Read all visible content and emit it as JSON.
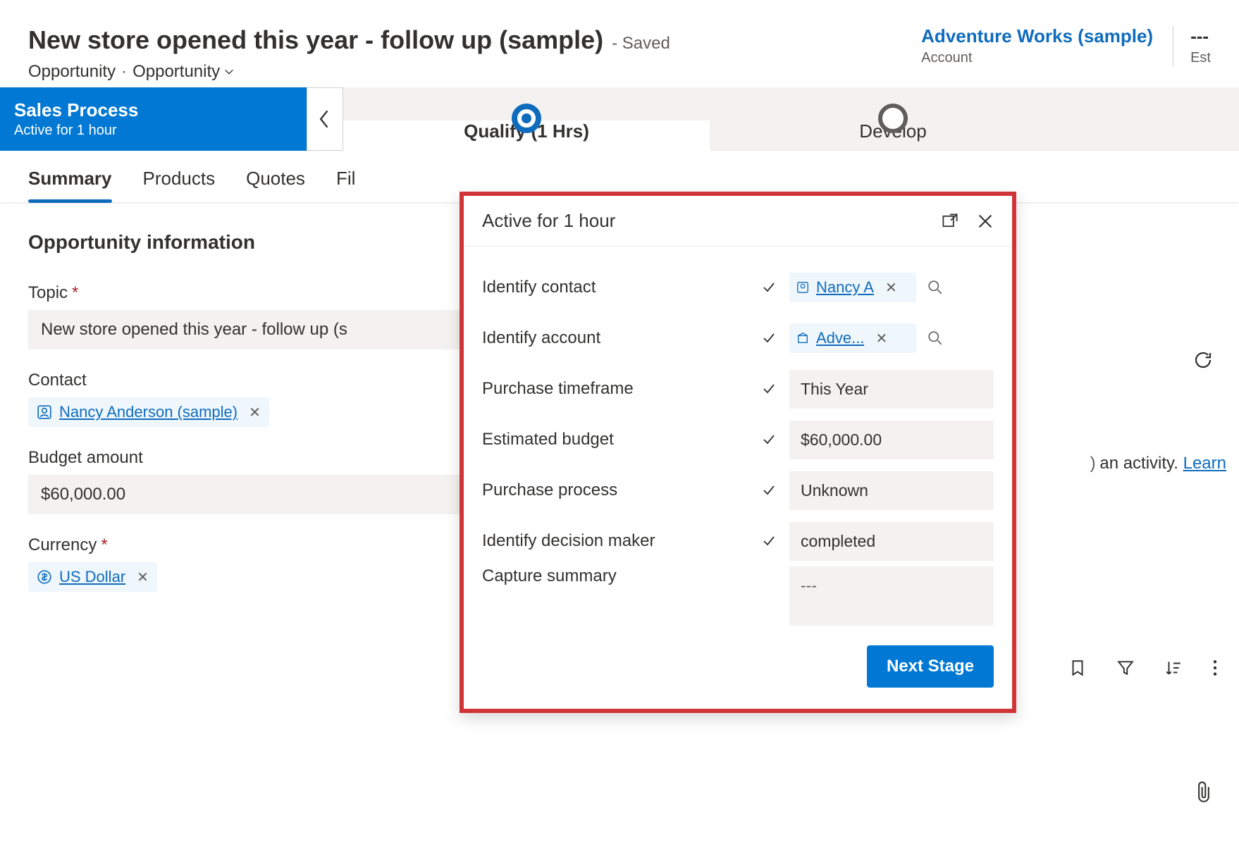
{
  "header": {
    "title": "New store opened this year - follow up (sample)",
    "saved_label": "- Saved",
    "entity": "Opportunity",
    "form_selector": "Opportunity",
    "right": {
      "account_link": "Adventure Works (sample)",
      "account_label": "Account",
      "est_dashes": "---",
      "est_label_partial": "Est"
    }
  },
  "bpf": {
    "name": "Sales Process",
    "active_for": "Active for 1 hour",
    "stages": [
      {
        "label": "Qualify  (1 Hrs)",
        "active": true
      },
      {
        "label": "Develop",
        "active": false
      }
    ]
  },
  "tabs": [
    {
      "label": "Summary",
      "active": true
    },
    {
      "label": "Products",
      "active": false
    },
    {
      "label": "Quotes",
      "active": false
    },
    {
      "label": "Fil",
      "active": false
    }
  ],
  "form": {
    "section": "Opportunity information",
    "topic": {
      "label": "Topic",
      "required": true,
      "value": "New store opened this year - follow up (s"
    },
    "contact": {
      "label": "Contact",
      "value": "Nancy Anderson (sample)"
    },
    "budget": {
      "label": "Budget amount",
      "value": "$60,000.00"
    },
    "currency": {
      "label": "Currency",
      "required": true,
      "value": "US Dollar"
    }
  },
  "flyout": {
    "title": "Active for 1 hour",
    "rows": [
      {
        "label": "Identify contact",
        "checked": true,
        "type": "lookup-contact",
        "value": "Nancy A"
      },
      {
        "label": "Identify account",
        "checked": true,
        "type": "lookup-account",
        "value": "Adve..."
      },
      {
        "label": "Purchase timeframe",
        "checked": true,
        "type": "text",
        "value": "This Year"
      },
      {
        "label": "Estimated budget",
        "checked": true,
        "type": "text",
        "value": "$60,000.00"
      },
      {
        "label": "Purchase process",
        "checked": true,
        "type": "text",
        "value": "Unknown"
      },
      {
        "label": "Identify decision maker",
        "checked": true,
        "type": "text",
        "value": "completed"
      },
      {
        "label": "Capture summary",
        "checked": false,
        "type": "textarea",
        "value": "---"
      }
    ],
    "next_label": "Next Stage"
  },
  "fragments": {
    "activity_partial": "an activity. ",
    "learn": "Learn"
  }
}
